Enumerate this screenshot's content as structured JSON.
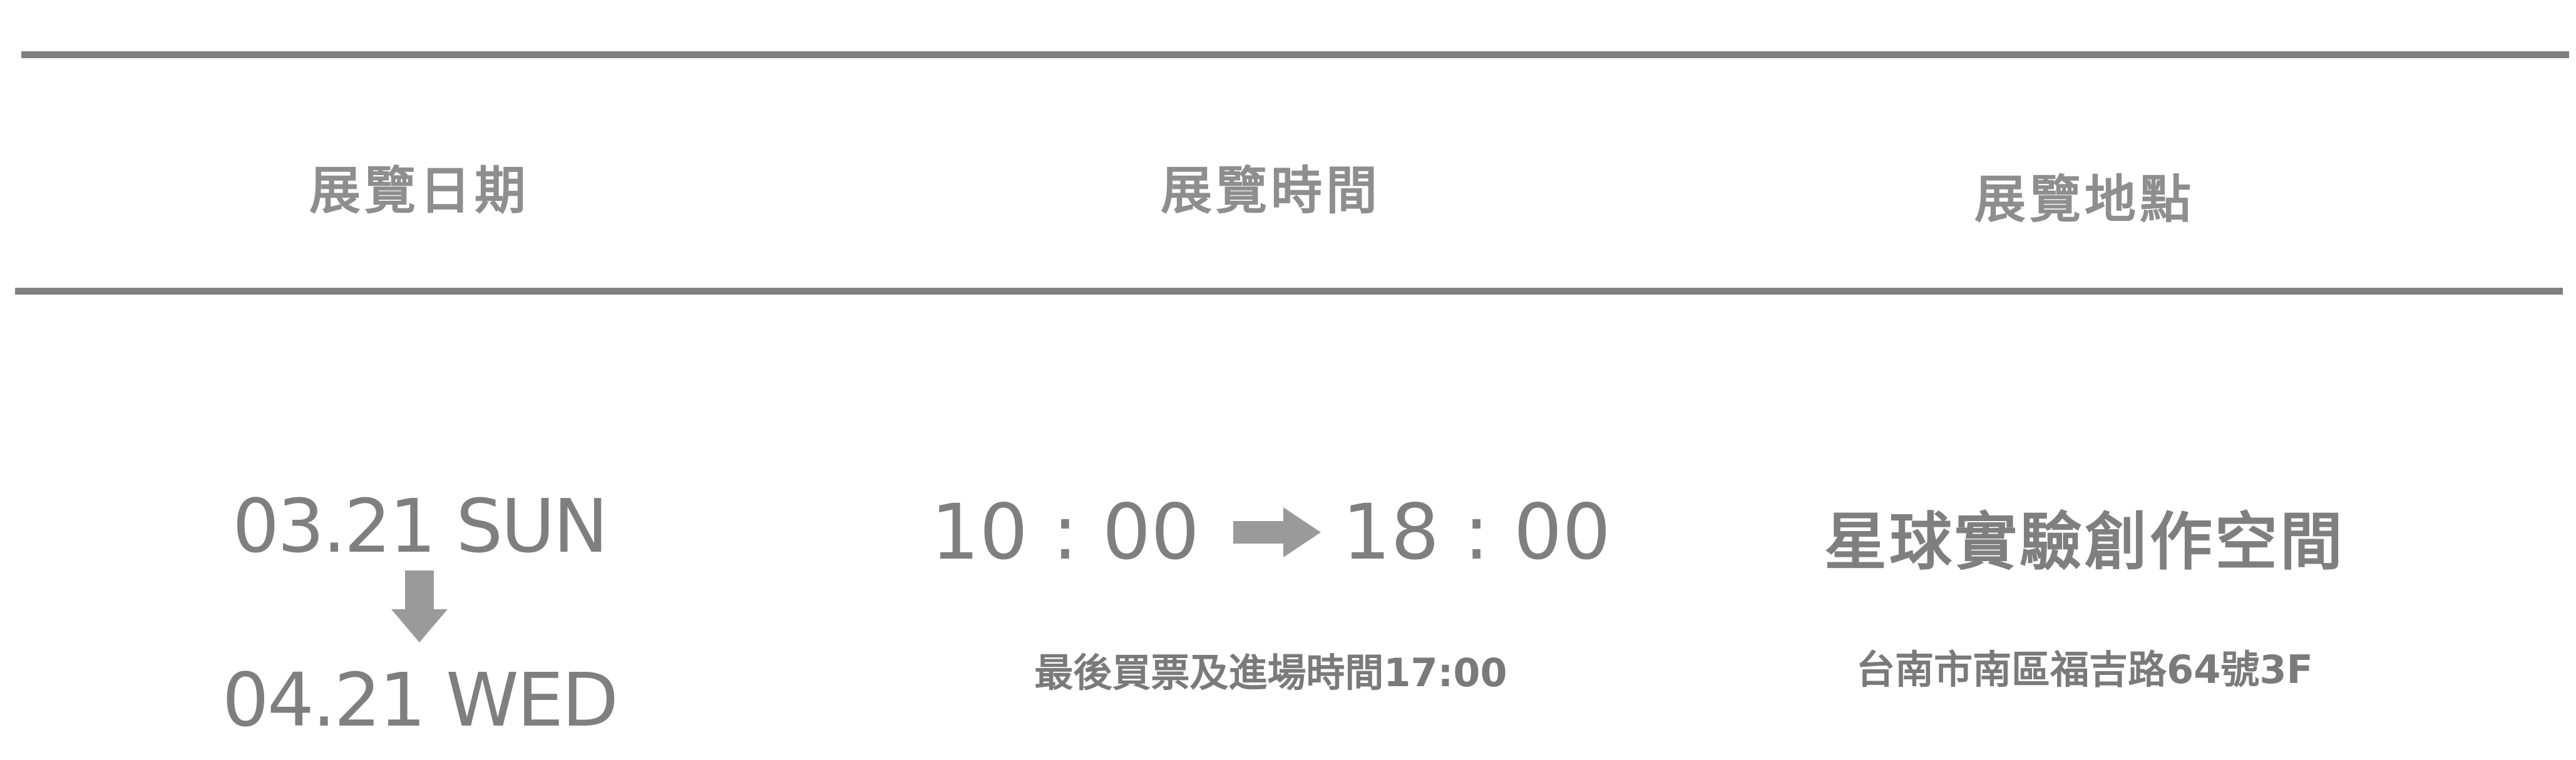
{
  "headers": {
    "date": "展覽日期",
    "time": "展覽時間",
    "place": "展覽地點"
  },
  "date": {
    "start": "03.21 SUN",
    "end": "04.21 WED",
    "arrow_icon": "down-arrow-icon"
  },
  "time": {
    "open": "10 : 00",
    "close": "18 : 00",
    "arrow_icon": "right-arrow-icon",
    "note": "最後買票及進場時間17:00"
  },
  "place": {
    "venue": "星球實驗創作空間",
    "address": "台南市南區福吉路64號3F"
  },
  "colors": {
    "rule": "#808080",
    "text": "#7f7f7f",
    "arrow": "#9a9a9a"
  }
}
